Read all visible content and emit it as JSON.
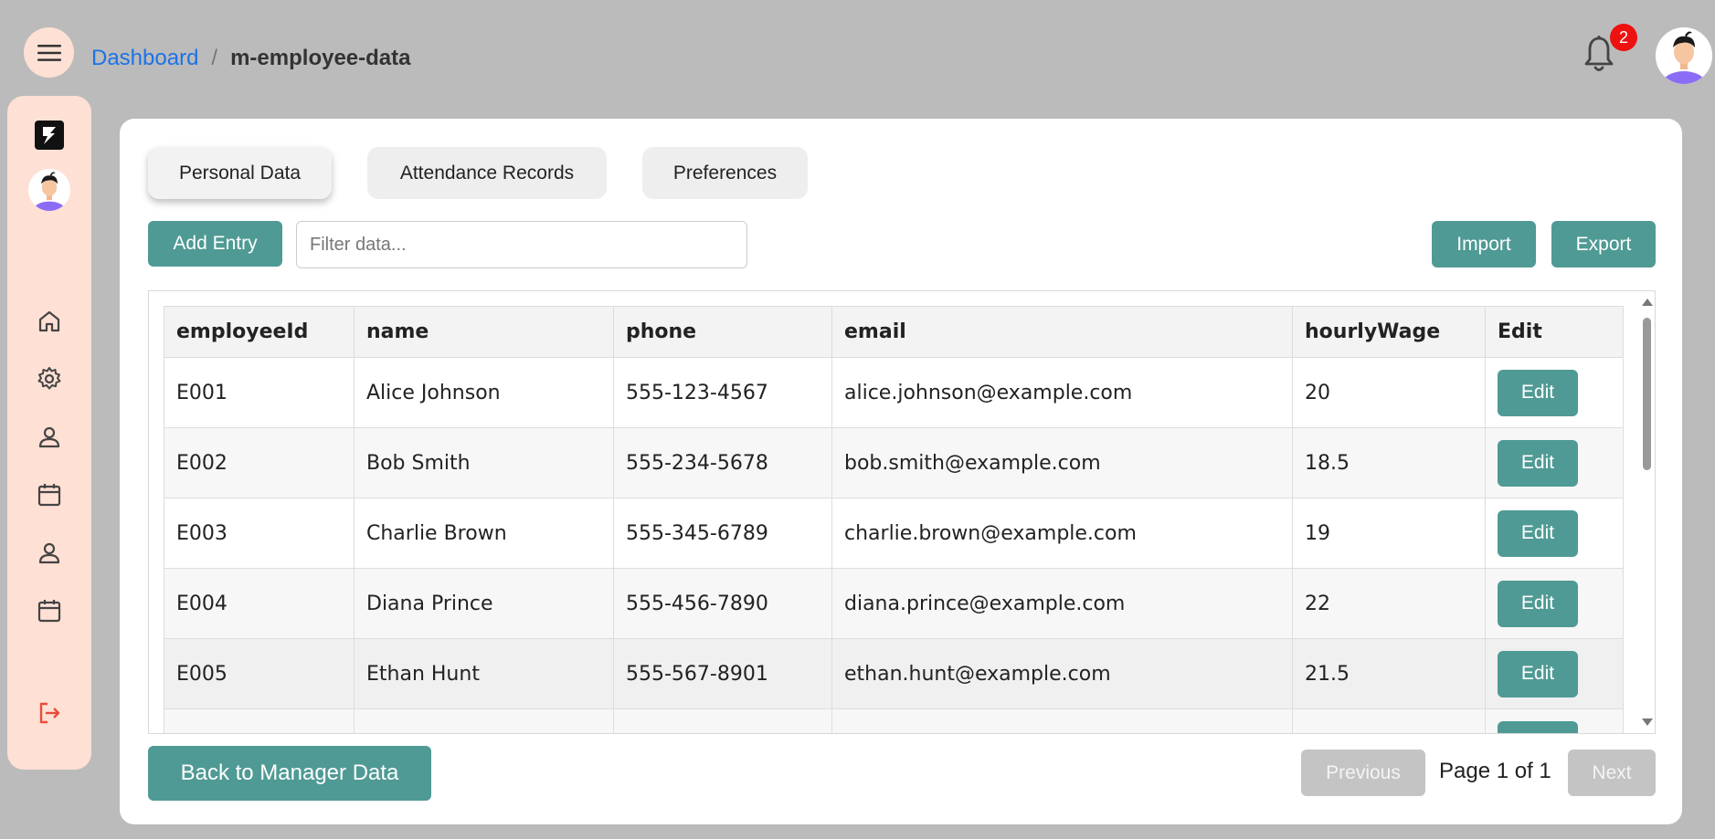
{
  "header": {
    "breadcrumb_link": "Dashboard",
    "breadcrumb_sep": "/",
    "breadcrumb_current": "m-employee-data",
    "notification_count": "2"
  },
  "sidebar": {
    "icons": [
      "home-icon",
      "gear-icon",
      "user-icon",
      "calendar-icon",
      "user-icon",
      "calendar-icon",
      "logout-icon"
    ]
  },
  "tabs": [
    {
      "label": "Personal Data",
      "active": true
    },
    {
      "label": "Attendance Records",
      "active": false
    },
    {
      "label": "Preferences",
      "active": false
    }
  ],
  "toolbar": {
    "add_label": "Add Entry",
    "filter_placeholder": "Filter data...",
    "import_label": "Import",
    "export_label": "Export"
  },
  "table": {
    "columns": [
      "employeeId",
      "name",
      "phone",
      "email",
      "hourlyWage",
      "Edit"
    ],
    "edit_label": "Edit",
    "rows": [
      {
        "employeeId": "E001",
        "name": "Alice Johnson",
        "phone": "555-123-4567",
        "email": "alice.johnson@example.com",
        "hourlyWage": "20"
      },
      {
        "employeeId": "E002",
        "name": "Bob Smith",
        "phone": "555-234-5678",
        "email": "bob.smith@example.com",
        "hourlyWage": "18.5"
      },
      {
        "employeeId": "E003",
        "name": "Charlie Brown",
        "phone": "555-345-6789",
        "email": "charlie.brown@example.com",
        "hourlyWage": "19"
      },
      {
        "employeeId": "E004",
        "name": "Diana Prince",
        "phone": "555-456-7890",
        "email": "diana.prince@example.com",
        "hourlyWage": "22"
      },
      {
        "employeeId": "E005",
        "name": "Ethan Hunt",
        "phone": "555-567-8901",
        "email": "ethan.hunt@example.com",
        "hourlyWage": "21.5"
      }
    ]
  },
  "footer": {
    "back_label": "Back to Manager Data",
    "previous_label": "Previous",
    "page_info": "Page 1 of 1",
    "next_label": "Next"
  },
  "colors": {
    "accent": "#4f9a94",
    "sidebar_bg": "#ffe0d4",
    "link": "#1a73e8",
    "badge": "#ee1111"
  }
}
